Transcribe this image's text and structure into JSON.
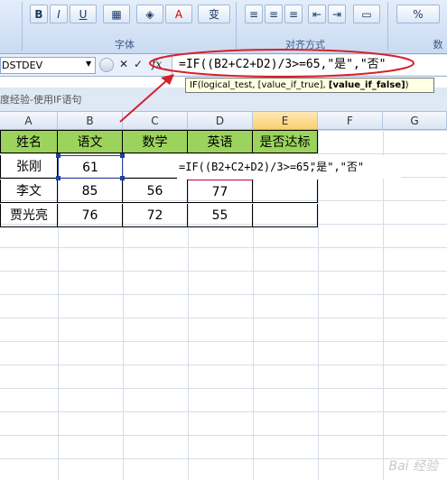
{
  "ribbon": {
    "font_group_label": "字体",
    "align_group_label": "对齐方式",
    "number_group_label": "数",
    "bold_label": "B",
    "italic_label": "I",
    "underline_label": "U",
    "font_color_label": "A",
    "phonetic_label": "变"
  },
  "formula_bar": {
    "name_box": "DSTDEV",
    "fx_label": "fx",
    "formula": "=IF((B2+C2+D2)/3>=65,\"是\",\"否\""
  },
  "tooltip": {
    "text_prefix": "IF(logical_test, [value_if_true], ",
    "text_bold": "[value_if_false]",
    "text_suffix": ")"
  },
  "window_tab": {
    "title": "度经验-使用IF语句"
  },
  "columns": [
    "A",
    "B",
    "C",
    "D",
    "E",
    "F",
    "G"
  ],
  "table": {
    "headers": [
      "姓名",
      "语文",
      "数学",
      "英语",
      "是否达标"
    ],
    "rows": [
      {
        "name": "张刚",
        "chinese": "61",
        "math": "",
        "english": "",
        "ok": ""
      },
      {
        "name": "李文",
        "chinese": "85",
        "math": "56",
        "english": "77",
        "ok": ""
      },
      {
        "name": "贾光亮",
        "chinese": "76",
        "math": "72",
        "english": "55",
        "ok": ""
      }
    ]
  },
  "cell_edit": {
    "formula_prefix": "=IF((B2+C2+D2)/3>=65,",
    "formula_suffix": "\"是\",\"否\""
  },
  "watermark": "Bai 经验",
  "colors": {
    "header_green": "#9bd35c",
    "annotation_red": "#d6202a",
    "c2_ref": "#2e8b2e",
    "d2_ref": "#8a2be2"
  }
}
